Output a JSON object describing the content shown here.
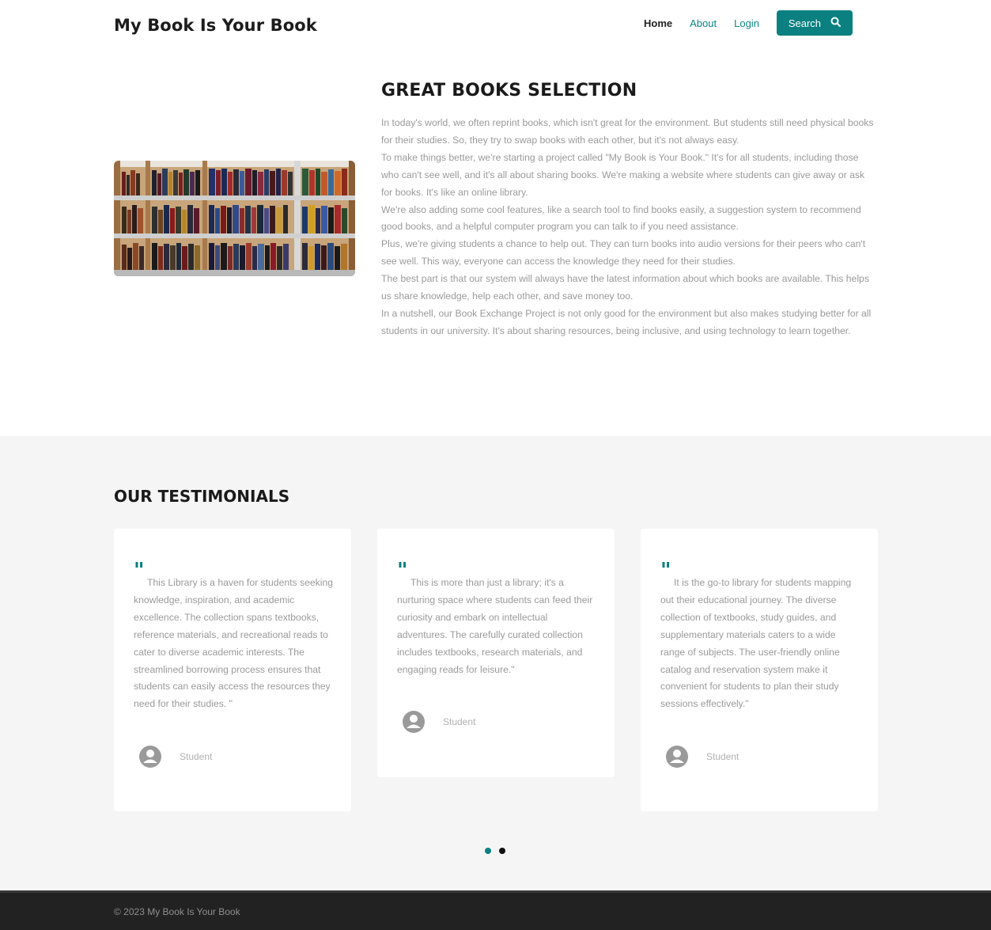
{
  "header": {
    "brand": "My Book Is Your Book",
    "nav": {
      "home": "Home",
      "about": "About",
      "login": "Login",
      "search": "Search"
    }
  },
  "about": {
    "title": "GREAT BOOKS SELECTION",
    "paragraphs": [
      "In today's world, we often reprint books, which isn't great for the environment. But students still need physical books for their studies. So, they try to swap books with each other, but it's not always easy.",
      "To make things better, we're starting a project called \"My Book is Your Book.\" It's for all students, including those who can't see well, and it's all about sharing books. We're making a website where students can give away or ask for books. It's like an online library.",
      "We're also adding some cool features, like a search tool to find books easily, a suggestion system to recommend good books, and a helpful computer program you can talk to if you need assistance.",
      "Plus, we're giving students a chance to help out. They can turn books into audio versions for their peers who can't see well. This way, everyone can access the knowledge they need for their studies.",
      "The best part is that our system will always have the latest information about which books are available. This helps us share knowledge, help each other, and save money too.",
      "In a nutshell, our Book Exchange Project is not only good for the environment but also makes studying better for all students in our university. It's about sharing resources, being inclusive, and using technology to learn together."
    ]
  },
  "testimonials": {
    "title": "OUR TESTIMONIALS",
    "items": [
      {
        "quote": "This Library is a haven for students seeking knowledge, inspiration, and academic excellence. The collection spans textbooks, reference materials, and recreational reads to cater to diverse academic interests. The streamlined borrowing process ensures that students can easily access the resources they need for their studies. \"",
        "author": "Student"
      },
      {
        "quote": "This is more than just a library; it's a nurturing space where students can feed their curiosity and embark on intellectual adventures. The carefully curated collection includes textbooks, research materials, and engaging reads for leisure.\"",
        "author": "Student"
      },
      {
        "quote": "It is the go-to library for students mapping out their educational journey. The diverse collection of textbooks, study guides, and supplementary materials caters to a wide range of subjects. The user-friendly online catalog and reservation system make it convenient for students to plan their study sessions effectively.\"",
        "author": "Student"
      }
    ]
  },
  "footer": {
    "copyright": "© 2023 My Book Is Your Book"
  },
  "colors": {
    "accent": "#0a8080",
    "footer_bg": "#222222",
    "section_bg": "#f5f5f5"
  }
}
